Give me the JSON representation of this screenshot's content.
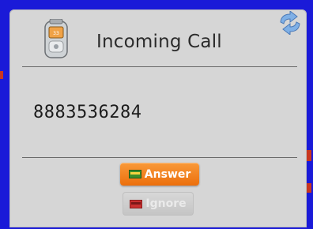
{
  "dialog": {
    "title": "Incoming Call",
    "caller_number": "8883536284"
  },
  "buttons": {
    "answer_label": "Answer",
    "ignore_label": "Ignore"
  },
  "icons": {
    "title_icon": "mobile-phone-icon",
    "corner_icon": "refresh-icon",
    "answer_icon": "answer-phone-icon",
    "ignore_icon": "ignore-phone-icon"
  },
  "colors": {
    "background": "#1a1ad8",
    "dialog_bg": "#d6d6d6",
    "answer_button": "#f0790f",
    "ignore_button": "#cfcfcf"
  }
}
